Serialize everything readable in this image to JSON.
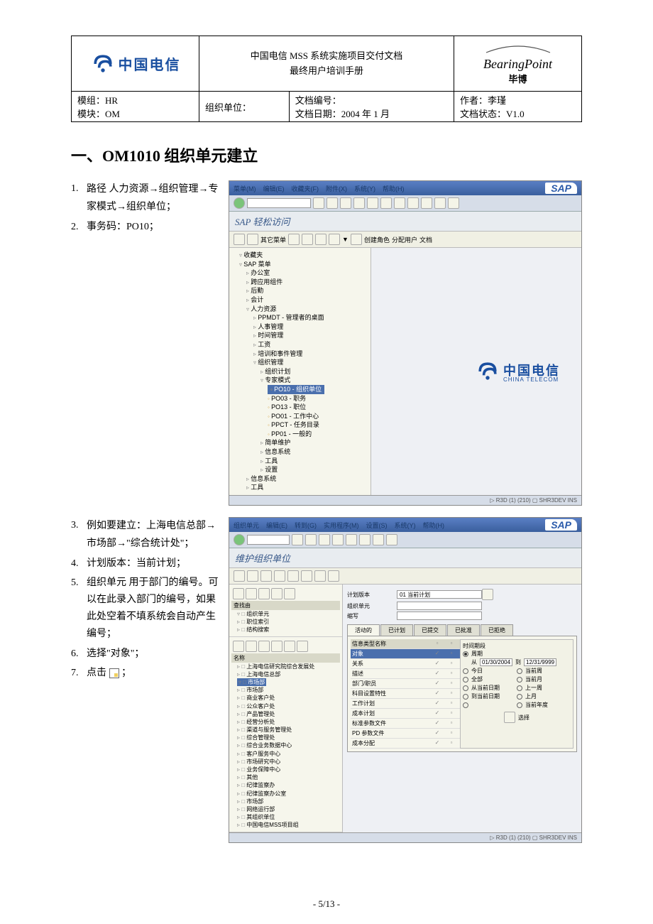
{
  "header": {
    "title_line1": "中国电信 MSS 系统实施项目交付文档",
    "title_line2": "最终用户培训手册",
    "logo_text": "中国电信",
    "bp_name": "BearingPoint",
    "bp_sub": "毕博",
    "meta": {
      "mod1": "模组：HR",
      "mod2": "模块：OM",
      "org": "组织单位：",
      "docno": "文档编号：",
      "docdate": "文档日期：2004 年 1 月",
      "author": "作者：李瑾",
      "status": "文档状态：V1.0"
    }
  },
  "section_title": "一、OM1010  组织单元建立",
  "steps1": [
    {
      "n": "1.",
      "t": "路径 人力资源→组织管理→专家模式→组织单位；"
    },
    {
      "n": "2.",
      "t": "事务码：PO10；"
    }
  ],
  "steps2": [
    {
      "n": "3.",
      "t": "例如要建立：上海电信总部→市场部→\"综合统计处\"；"
    },
    {
      "n": "4.",
      "t": "计划版本：当前计划；"
    },
    {
      "n": "5.",
      "t": "组织单元 用于部门的编号。可以在此录入部门的编号，如果此处空着不填系统会自动产生编号；"
    },
    {
      "n": "6.",
      "t": "选择\"对象\"；"
    },
    {
      "n": "7.",
      "t": "点击 □ ；"
    }
  ],
  "sap1": {
    "menus": [
      "菜单(M)",
      "编辑(E)",
      "收藏夹(F)",
      "附件(X)",
      "系统(Y)",
      "帮助(H)"
    ],
    "subtitle": "SAP 轻松访问",
    "toolbar2_labels": [
      "其它菜单",
      "创建角色",
      "分配用户",
      "文档"
    ],
    "tree": {
      "root": "收藏夹",
      "sap_menu": "SAP 菜单",
      "items": [
        "办公室",
        "跨应用组件",
        "后勤",
        "会计"
      ],
      "hr": "人力资源",
      "hr_items": [
        "PPMDT - 管理者的桌面",
        "人事管理",
        "时间管理",
        "工资",
        "培训和事件管理"
      ],
      "om": "组织管理",
      "om_items": [
        "组织计划"
      ],
      "expert": "专家模式",
      "expert_items": [
        "PO10 - 组织单位",
        "PO03 - 职务",
        "PO13 - 职位",
        "PO01 - 工作中心",
        "PPCT - 任务目录",
        "PP01 - 一般的"
      ],
      "after": [
        "简单维护",
        "信息系统",
        "工具",
        "设置"
      ],
      "tail": [
        "信息系统",
        "工具"
      ]
    },
    "watermark_sub": "CHINA TELECOM",
    "status": "▷ R3D (1) (210) ▢ SHR3DEV  INS"
  },
  "sap2": {
    "menus": [
      "组织单元",
      "编辑(E)",
      "转到(G)",
      "实用程序(M)",
      "设置(S)",
      "系统(Y)",
      "帮助(H)"
    ],
    "subtitle": "维护组织单位",
    "left_search": "查找由",
    "left_items1": [
      "组织单元",
      "职位索引",
      "结构搜索"
    ],
    "left_hdr2": "名称",
    "left_tree": [
      "上海电信研究院综合发展处",
      "上海电信总部",
      "市场部",
      "市场部",
      "商业客户处",
      "公众客户处",
      "产品管理处",
      "经营分析处",
      "渠道与服务管理处",
      "综合管理处",
      "综合业务数据中心",
      "客户服务中心",
      "市场研究中心",
      "业务保障中心",
      "其他",
      "纪律监察办",
      "纪律监察办公室",
      "市场部",
      "网络运行部",
      "其组织单位",
      "中国电信MSS项目组"
    ],
    "form": {
      "plan_lbl": "计划版本",
      "plan_val": "01  当前计划",
      "org_lbl": "组织单元",
      "abbr_lbl": "缩写"
    },
    "tabs": [
      "活动的",
      "已计划",
      "已提交",
      "已批准",
      "已拒绝"
    ],
    "info_header": "信息类型名称",
    "info_rows": [
      "对象",
      "关系",
      "描述",
      "部门/职员",
      "科目设置特性",
      "工作计划",
      "成本计划",
      "标准参数文件",
      "PD 参数文件",
      "成本分配"
    ],
    "period": {
      "title": "时间期段",
      "opt_period": "周期",
      "from_lbl": "从",
      "from_val": "01/30/2004",
      "to_lbl": "到",
      "to_val": "12/31/9999",
      "opts": [
        [
          "今日",
          "当前周"
        ],
        [
          "全部",
          "当前月"
        ],
        [
          "从当前日期",
          "上一周"
        ],
        [
          "到当前日期",
          "上月"
        ],
        [
          "",
          "当前年度"
        ]
      ],
      "select_btn": "选择"
    },
    "status": "▷ R3D (1) (210) ▢ SHR3DEV  INS"
  },
  "footer": "- 5/13 -"
}
